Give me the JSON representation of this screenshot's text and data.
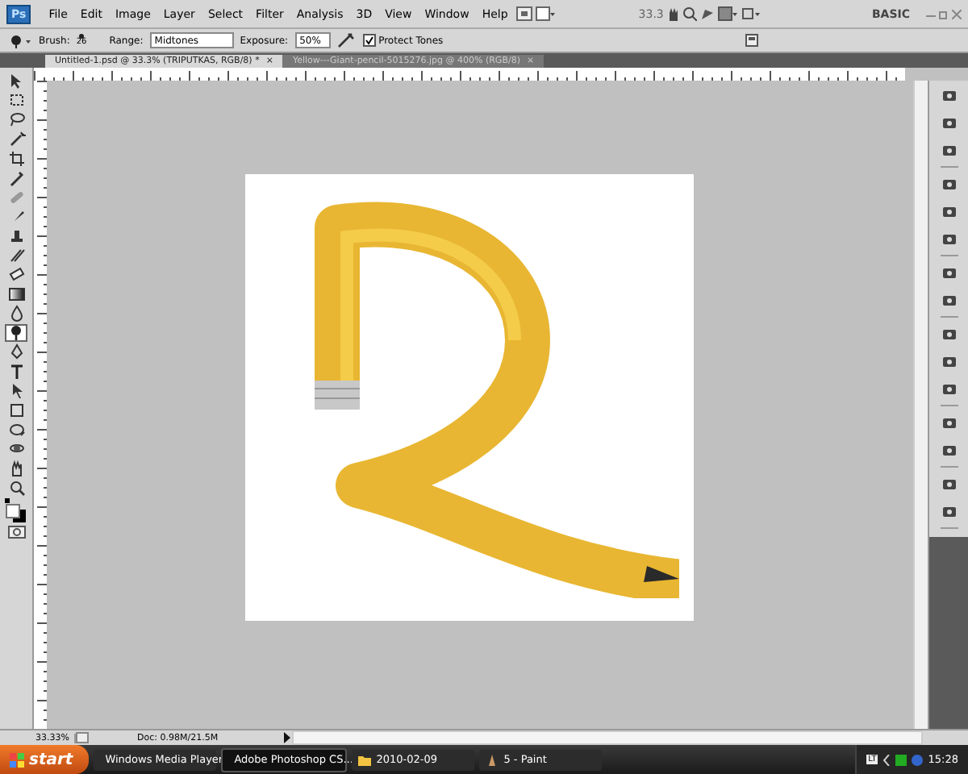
{
  "menubar": {
    "logo": "Ps",
    "menus": [
      "File",
      "Edit",
      "Image",
      "Layer",
      "Select",
      "Filter",
      "Analysis",
      "3D",
      "View",
      "Window",
      "Help"
    ],
    "zoom": "33.3",
    "workspace": "BASIC"
  },
  "options": {
    "brush_label": "Brush:",
    "brush_size": "26",
    "range_label": "Range:",
    "range": "Midtones",
    "exposure_label": "Exposure:",
    "exposure": "50%",
    "protect_tones": {
      "label": "Protect Tones",
      "checked": true
    }
  },
  "tabs": [
    {
      "label": "Untitled-1.psd @ 33.3% (TRIPUTKAS, RGB/8) *",
      "close": "×",
      "selected": true
    },
    {
      "label": "Yellow---Giant-pencil-5015276.jpg @ 400% (RGB/8)",
      "close": "×",
      "selected": false
    }
  ],
  "tools": [
    {
      "kind": "move",
      "selected": false
    },
    {
      "kind": "marquee",
      "selected": false
    },
    {
      "kind": "lasso",
      "selected": false
    },
    {
      "kind": "wand",
      "selected": false
    },
    {
      "kind": "crop",
      "selected": false
    },
    {
      "kind": "eyedropper",
      "selected": false
    },
    {
      "kind": "heal",
      "selected": false
    },
    {
      "kind": "brush",
      "selected": false
    },
    {
      "kind": "stamp",
      "selected": false
    },
    {
      "kind": "history",
      "selected": false
    },
    {
      "kind": "eraser",
      "selected": false
    },
    {
      "kind": "gradient",
      "selected": false
    },
    {
      "kind": "blur",
      "selected": false
    },
    {
      "kind": "dodge",
      "selected": true
    },
    {
      "kind": "pen",
      "selected": false
    },
    {
      "kind": "type",
      "selected": false
    },
    {
      "kind": "path",
      "selected": false
    },
    {
      "kind": "shape",
      "selected": false
    },
    {
      "kind": "rotate",
      "selected": false
    },
    {
      "kind": "orbit",
      "selected": false
    },
    {
      "kind": "hand",
      "selected": false
    },
    {
      "kind": "zoom",
      "selected": false
    }
  ],
  "status_bar": {
    "zoom": "33.33%",
    "doc": "Doc: 0.98M/21.5M"
  },
  "taskbar": {
    "start": "start",
    "items": [
      {
        "label": "Windows Media Player",
        "selected": false
      },
      {
        "label": "Adobe Photoshop CS...",
        "selected": true
      },
      {
        "label": "2010-02-09",
        "selected": false
      },
      {
        "label": "5 - Paint",
        "selected": false
      }
    ],
    "tray_badge": "LT",
    "clock": "15:28"
  }
}
